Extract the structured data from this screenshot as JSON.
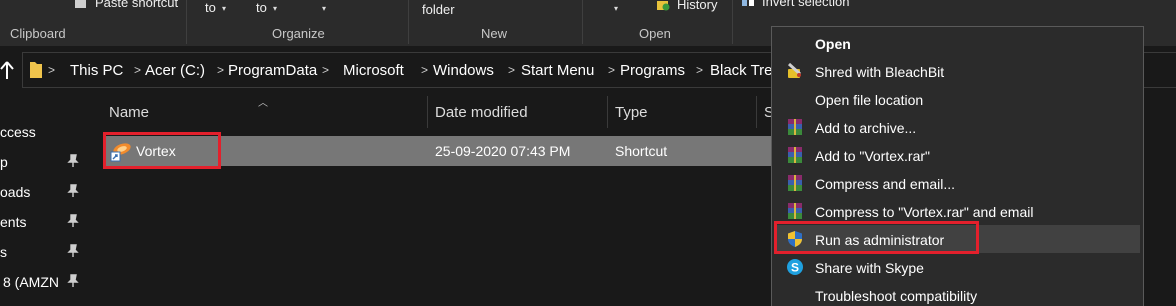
{
  "ribbon": {
    "paste_shortcut": "Paste shortcut",
    "move_to": "to",
    "copy_to": "to",
    "new_folder": "folder",
    "history": "History",
    "invert_selection": "Invert selection",
    "groups": {
      "clipboard": "Clipboard",
      "organize": "Organize",
      "new": "New",
      "open": "Open"
    }
  },
  "breadcrumb": [
    "This PC",
    "Acer (C:)",
    "ProgramData",
    "Microsoft",
    "Windows",
    "Start Menu",
    "Programs",
    "Black Tree"
  ],
  "nav_pane": {
    "items": [
      "ccess",
      "p",
      "oads",
      "ents",
      "s",
      "8 (AMZN"
    ]
  },
  "file_list": {
    "columns": [
      "Name",
      "Date modified",
      "Type",
      "S"
    ],
    "rows": [
      {
        "name": "Vortex",
        "date_modified": "25-09-2020 07:43 PM",
        "type": "Shortcut",
        "icon": "vortex-shortcut-icon"
      }
    ]
  },
  "context_menu": {
    "items": [
      {
        "label": "Open",
        "icon": ""
      },
      {
        "label": "Shred with BleachBit",
        "icon": "bleachbit-icon"
      },
      {
        "label": "Open file location",
        "icon": ""
      },
      {
        "label": "Add to archive...",
        "icon": "winrar-icon"
      },
      {
        "label": "Add to \"Vortex.rar\"",
        "icon": "winrar-icon"
      },
      {
        "label": "Compress and email...",
        "icon": "winrar-icon"
      },
      {
        "label": "Compress to \"Vortex.rar\" and email",
        "icon": "winrar-icon"
      },
      {
        "label": "Run as administrator",
        "icon": "uac-shield-icon"
      },
      {
        "label": "Share with Skype",
        "icon": "skype-icon"
      },
      {
        "label": "Troubleshoot compatibility",
        "icon": ""
      }
    ]
  },
  "colors": {
    "background": "#191919",
    "ribbon": "#2b2b2b",
    "menu": "#2b2b2b",
    "selection": "#777777",
    "highlight_box": "#e3202c"
  }
}
